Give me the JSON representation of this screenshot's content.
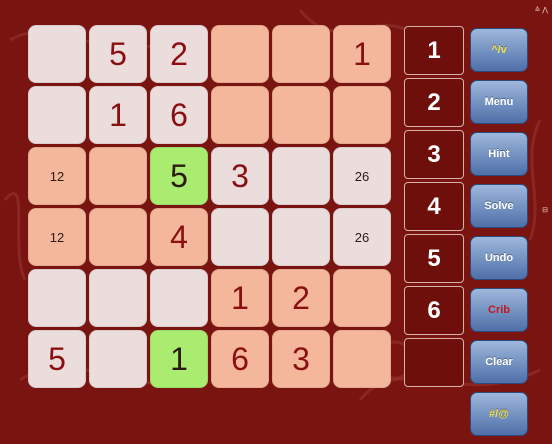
{
  "grid": {
    "rows": [
      [
        {
          "color": "pink",
          "value": "",
          "clue": ""
        },
        {
          "color": "pink",
          "value": "5",
          "clue": ""
        },
        {
          "color": "pink",
          "value": "2",
          "clue": ""
        },
        {
          "color": "peach",
          "value": "",
          "clue": ""
        },
        {
          "color": "peach",
          "value": "",
          "clue": ""
        },
        {
          "color": "peach",
          "value": "1",
          "clue": ""
        }
      ],
      [
        {
          "color": "pink",
          "value": "",
          "clue": ""
        },
        {
          "color": "pink",
          "value": "1",
          "clue": ""
        },
        {
          "color": "pink",
          "value": "6",
          "clue": ""
        },
        {
          "color": "peach",
          "value": "",
          "clue": ""
        },
        {
          "color": "peach",
          "value": "",
          "clue": ""
        },
        {
          "color": "peach",
          "value": "",
          "clue": ""
        }
      ],
      [
        {
          "color": "peach",
          "value": "",
          "clue": "12"
        },
        {
          "color": "peach",
          "value": "",
          "clue": ""
        },
        {
          "color": "green",
          "value": "5",
          "clue": ""
        },
        {
          "color": "pink",
          "value": "3",
          "clue": ""
        },
        {
          "color": "pink",
          "value": "",
          "clue": ""
        },
        {
          "color": "pink",
          "value": "",
          "clue": "26"
        }
      ],
      [
        {
          "color": "peach",
          "value": "",
          "clue": "12"
        },
        {
          "color": "peach",
          "value": "",
          "clue": ""
        },
        {
          "color": "peach",
          "value": "4",
          "clue": ""
        },
        {
          "color": "pink",
          "value": "",
          "clue": ""
        },
        {
          "color": "pink",
          "value": "",
          "clue": ""
        },
        {
          "color": "pink",
          "value": "",
          "clue": "26"
        }
      ],
      [
        {
          "color": "pink",
          "value": "",
          "clue": ""
        },
        {
          "color": "pink",
          "value": "",
          "clue": ""
        },
        {
          "color": "pink",
          "value": "",
          "clue": ""
        },
        {
          "color": "peach",
          "value": "1",
          "clue": ""
        },
        {
          "color": "peach",
          "value": "2",
          "clue": ""
        },
        {
          "color": "peach",
          "value": "",
          "clue": ""
        }
      ],
      [
        {
          "color": "pink",
          "value": "5",
          "clue": ""
        },
        {
          "color": "pink",
          "value": "",
          "clue": ""
        },
        {
          "color": "green",
          "value": "1",
          "clue": ""
        },
        {
          "color": "peach",
          "value": "6",
          "clue": ""
        },
        {
          "color": "peach",
          "value": "3",
          "clue": ""
        },
        {
          "color": "peach",
          "value": "",
          "clue": ""
        }
      ]
    ]
  },
  "digits": [
    "1",
    "2",
    "3",
    "4",
    "5",
    "6",
    ""
  ],
  "actions": [
    {
      "label": "^/v",
      "style": "yellow"
    },
    {
      "label": "Menu",
      "style": ""
    },
    {
      "label": "Hint",
      "style": ""
    },
    {
      "label": "Solve",
      "style": ""
    },
    {
      "label": "Undo",
      "style": ""
    },
    {
      "label": "Crib",
      "style": "crib"
    },
    {
      "label": "Clear",
      "style": ""
    },
    {
      "label": "#/@",
      "style": "yellow"
    }
  ],
  "status": {
    "top": "≙ ⋀",
    "middle": "⊟"
  },
  "colors": {
    "background": "#7a1410",
    "pink": "#ecdddd",
    "peach": "#f4b79c",
    "green": "#a9ec70",
    "digit_text": "#8a0f12",
    "button_blue": "#5a7bb3"
  }
}
